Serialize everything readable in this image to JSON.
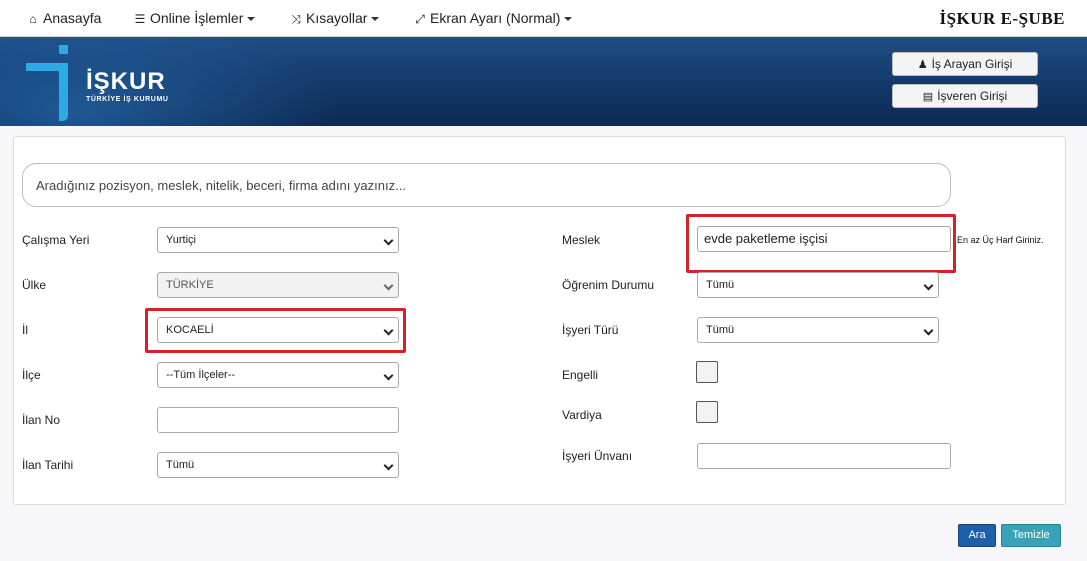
{
  "nav": {
    "items": [
      {
        "label": "Anasayfa",
        "icon": "home-icon",
        "glyph": "⌂",
        "dropdown": false
      },
      {
        "label": "Online İşlemler",
        "icon": "list-icon",
        "glyph": "☰",
        "dropdown": true
      },
      {
        "label": "Kısayollar",
        "icon": "shuffle-icon",
        "glyph": "⤨",
        "dropdown": true
      },
      {
        "label": "Ekran Ayarı (Normal)",
        "icon": "expand-icon",
        "glyph": "⤢",
        "dropdown": true
      }
    ],
    "brand": "İŞKUR E-ŞUBE"
  },
  "header": {
    "logo_text": "İŞKUR",
    "logo_subtitle": "TÜRKİYE İŞ KURUMU",
    "job_seeker_login": "İş Arayan Girişi",
    "employer_login": "İşveren Girişi"
  },
  "search": {
    "placeholder": "Aradığınız pozisyon, meslek, nitelik, beceri, firma adını yazınız..."
  },
  "form": {
    "left": {
      "work_place": {
        "label": "Çalışma Yeri",
        "value": "Yurtiçi"
      },
      "country": {
        "label": "Ülke",
        "value": "TÜRKİYE"
      },
      "province": {
        "label": "İl",
        "value": "KOCAELİ"
      },
      "district": {
        "label": "İlçe",
        "value": "--Tüm İlçeler--"
      },
      "listing_no": {
        "label": "İlan No",
        "value": ""
      },
      "listing_date": {
        "label": "İlan Tarihi",
        "value": "Tümü"
      }
    },
    "right": {
      "occupation": {
        "label": "Meslek",
        "value": "evde paketleme işçisi",
        "hint": "En az Üç Harf Giriniz."
      },
      "education": {
        "label": "Öğrenim Durumu",
        "value": "Tümü"
      },
      "employer_type": {
        "label": "İşyeri Türü",
        "value": "Tümü"
      },
      "disabled": {
        "label": "Engelli",
        "checked": false
      },
      "shift": {
        "label": "Vardiya",
        "checked": false
      },
      "employer_title": {
        "label": "İşyeri Ünvanı",
        "value": ""
      }
    }
  },
  "actions": {
    "search": "Ara",
    "clear": "Temizle"
  },
  "colors": {
    "highlight": "#d9202a",
    "banner": "#153e70",
    "search_button": "#1d5fa8",
    "clear_button": "#3aa2b8"
  }
}
